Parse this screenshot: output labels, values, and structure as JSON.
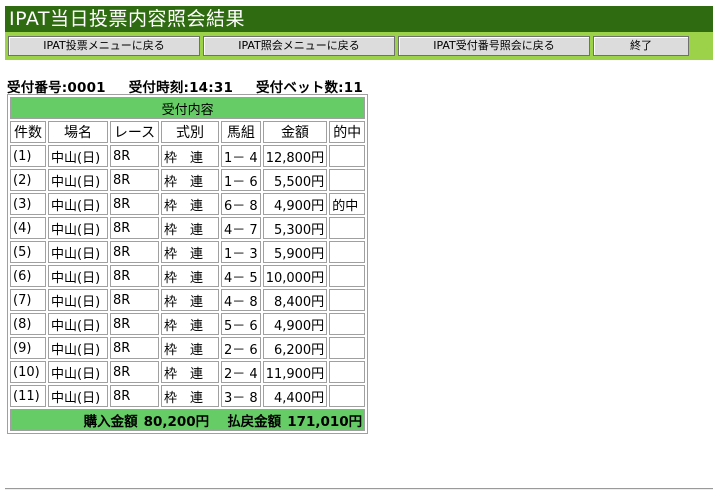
{
  "title": "IPAT当日投票内容照会結果",
  "nav": {
    "vote_menu": "IPAT投票メニューに戻る",
    "inquiry_menu": "IPAT照会メニューに戻る",
    "receipt_inquiry": "IPAT受付番号照会に戻る",
    "exit": "終了"
  },
  "summary": {
    "receipt_no": "受付番号:0001",
    "receipt_time": "受付時刻:14:31",
    "bet_count": "受付ベット数:11"
  },
  "table": {
    "caption": "受付内容",
    "headers": [
      "件数",
      "場名",
      "レース",
      "式別",
      "馬組",
      "金額",
      "的中"
    ],
    "rows": [
      {
        "no": "(1)",
        "venue": "中山(日)",
        "race": "8R",
        "type": "枠　連",
        "combo": "1－ 4",
        "amount": "12,800円",
        "hit": ""
      },
      {
        "no": "(2)",
        "venue": "中山(日)",
        "race": "8R",
        "type": "枠　連",
        "combo": "1－ 6",
        "amount": "5,500円",
        "hit": ""
      },
      {
        "no": "(3)",
        "venue": "中山(日)",
        "race": "8R",
        "type": "枠　連",
        "combo": "6－ 8",
        "amount": "4,900円",
        "hit": "的中"
      },
      {
        "no": "(4)",
        "venue": "中山(日)",
        "race": "8R",
        "type": "枠　連",
        "combo": "4－ 7",
        "amount": "5,300円",
        "hit": ""
      },
      {
        "no": "(5)",
        "venue": "中山(日)",
        "race": "8R",
        "type": "枠　連",
        "combo": "1－ 3",
        "amount": "5,900円",
        "hit": ""
      },
      {
        "no": "(6)",
        "venue": "中山(日)",
        "race": "8R",
        "type": "枠　連",
        "combo": "4－ 5",
        "amount": "10,000円",
        "hit": ""
      },
      {
        "no": "(7)",
        "venue": "中山(日)",
        "race": "8R",
        "type": "枠　連",
        "combo": "4－ 8",
        "amount": "8,400円",
        "hit": ""
      },
      {
        "no": "(8)",
        "venue": "中山(日)",
        "race": "8R",
        "type": "枠　連",
        "combo": "5－ 6",
        "amount": "4,900円",
        "hit": ""
      },
      {
        "no": "(9)",
        "venue": "中山(日)",
        "race": "8R",
        "type": "枠　連",
        "combo": "2－ 6",
        "amount": "6,200円",
        "hit": ""
      },
      {
        "no": "(10)",
        "venue": "中山(日)",
        "race": "8R",
        "type": "枠　連",
        "combo": "2－ 4",
        "amount": "11,900円",
        "hit": ""
      },
      {
        "no": "(11)",
        "venue": "中山(日)",
        "race": "8R",
        "type": "枠　連",
        "combo": "3－ 8",
        "amount": "4,400円",
        "hit": ""
      }
    ],
    "footer": {
      "purchase_label": "購入金額",
      "purchase_total": "80,200円",
      "refund_label": "払戻金額",
      "refund_total": "171,010円"
    }
  },
  "colors": {
    "title_bg": "#2f6b10",
    "nav_bg": "#9bd24a",
    "header_bg": "#66cc66"
  }
}
